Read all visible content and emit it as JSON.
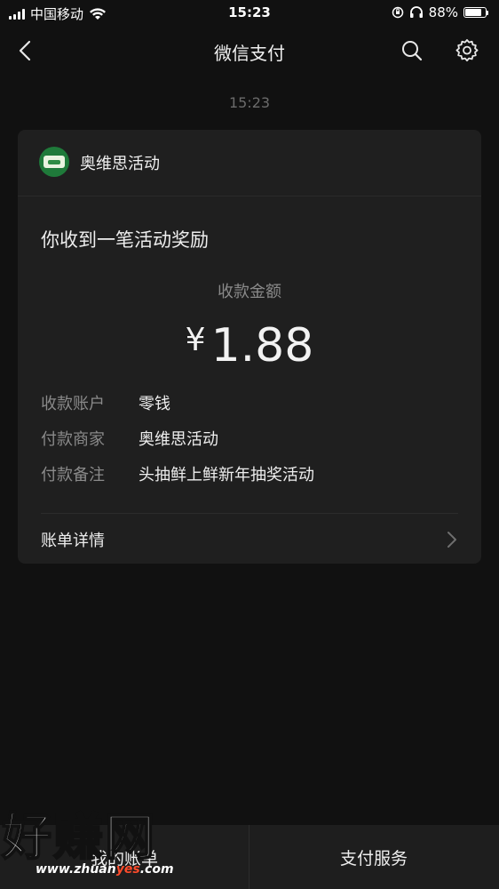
{
  "status_bar": {
    "carrier": "中国移动",
    "time": "15:23",
    "battery_percent": "88%",
    "battery_level": 0.88,
    "icons": [
      "signal-icon",
      "wifi-icon",
      "orientation-lock-icon",
      "headphones-icon",
      "battery-icon"
    ]
  },
  "nav": {
    "title": "微信支付",
    "icons": [
      "back-arrow-icon",
      "search-icon",
      "gear-icon"
    ]
  },
  "message": {
    "timestamp": "15:23"
  },
  "card": {
    "merchant_name": "奥维思活动",
    "heading": "你收到一笔活动奖励",
    "amount_label": "收款金额",
    "currency_symbol": "¥",
    "amount": "1.88",
    "details": [
      {
        "key": "收款账户",
        "value": "零钱"
      },
      {
        "key": "付款商家",
        "value": "奥维思活动"
      },
      {
        "key": "付款备注",
        "value": "头抽鲜上鲜新年抽奖活动"
      }
    ],
    "bill_detail_label": "账单详情"
  },
  "bottom_bar": {
    "left_tab": "我的账单",
    "right_tab": "支付服务"
  },
  "watermark": {
    "text": "好赚网",
    "url_prefix": "www.zhuan",
    "url_highlight": "yes",
    "url_suffix": ".com"
  },
  "colors": {
    "background": "#111111",
    "card": "#1f1f1f",
    "bottom_bar": "#1e1e1e",
    "merchant_logo": "#1f7a3a",
    "watermark_accent": "#ff4b2b"
  }
}
